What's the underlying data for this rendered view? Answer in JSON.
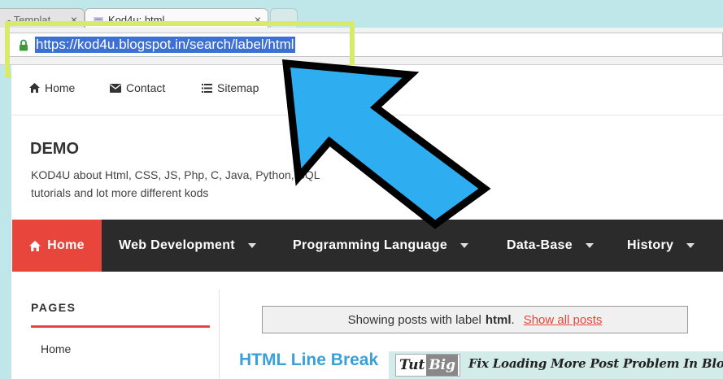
{
  "browser": {
    "tabs": [
      {
        "title": "- Templat",
        "active": false
      },
      {
        "title": "Kod4u: html",
        "active": true
      }
    ],
    "close_glyph": "×",
    "url": "https://kod4u.blogspot.in/search/label/html",
    "lock_icon": "lock-icon"
  },
  "topnav": {
    "items": [
      {
        "label": "Home",
        "icon": "home-icon"
      },
      {
        "label": "Contact",
        "icon": "envelope-icon"
      },
      {
        "label": "Sitemap",
        "icon": "list-icon"
      }
    ]
  },
  "site": {
    "title": "DEMO",
    "description": "KOD4U about Html, CSS, JS, Php, C, Java, Python, SQL tutorials and lot more different kods"
  },
  "mainnav": {
    "items": [
      {
        "label": "Home",
        "icon": "home-icon"
      },
      {
        "label": "Web Development"
      },
      {
        "label": "Programming Language"
      },
      {
        "label": "Data-Base"
      },
      {
        "label": "History"
      }
    ]
  },
  "sidebar": {
    "heading": "PAGES",
    "links": [
      "Home"
    ]
  },
  "notice": {
    "prefix": "Showing posts with label",
    "label": "html",
    "suffix": ".",
    "link": "Show all posts"
  },
  "post": {
    "title": "HTML Line Break"
  },
  "overlay": {
    "logo_left": "Tut",
    "logo_right": "Big",
    "banner_text": "Fix Loading More Post Problem In Blogger"
  },
  "colors": {
    "accent_red": "#e8453c",
    "highlight_green": "#d7ea6a",
    "arrow_blue": "#2eaef0",
    "post_title_blue": "#3aa0d9"
  }
}
